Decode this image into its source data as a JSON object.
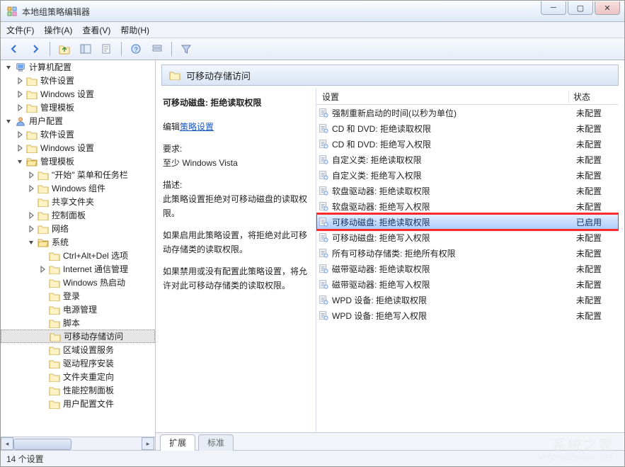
{
  "window": {
    "title": "本地组策略编辑器",
    "min_tooltip": "最小化",
    "max_tooltip": "最大化",
    "close_tooltip": "关闭"
  },
  "menubar": {
    "file": "文件(F)",
    "action": "操作(A)",
    "view": "查看(V)",
    "help": "帮助(H)"
  },
  "toolbar_icons": {
    "back": "back-arrow-icon",
    "forward": "forward-arrow-icon",
    "up": "up-folder-icon",
    "show_hide": "show-hide-tree-icon",
    "properties": "properties-icon",
    "help": "help-icon",
    "options": "options-icon",
    "filter": "filter-icon"
  },
  "tree": {
    "root1": "计算机配置",
    "root1_children": {
      "a": "软件设置",
      "b": "Windows 设置",
      "c": "管理模板"
    },
    "root2": "用户配置",
    "root2_children": {
      "a": "软件设置",
      "b": "Windows 设置",
      "c": "管理模板",
      "c_children": {
        "a": "\"开始\" 菜单和任务栏",
        "b": "Windows 组件",
        "c": "共享文件夹",
        "d": "控制面板",
        "e": "网络",
        "f": "系统",
        "f_children": {
          "a": "Ctrl+Alt+Del 选项",
          "b": "Internet 通信管理",
          "c": "Windows 热启动",
          "d": "登录",
          "e": "电源管理",
          "f": "脚本",
          "g": "可移动存储访问",
          "h": "区域设置服务",
          "i": "驱动程序安装",
          "j": "文件夹重定向",
          "k": "性能控制面板",
          "l": "用户配置文件"
        }
      }
    }
  },
  "content": {
    "header_title": "可移动存储访问",
    "columns": {
      "setting": "设置",
      "state": "状态"
    },
    "rows": [
      {
        "name": "强制重新启动的时间(以秒为单位)",
        "state": "未配置"
      },
      {
        "name": "CD 和 DVD: 拒绝读取权限",
        "state": "未配置"
      },
      {
        "name": "CD 和 DVD: 拒绝写入权限",
        "state": "未配置"
      },
      {
        "name": "自定义类: 拒绝读取权限",
        "state": "未配置"
      },
      {
        "name": "自定义类: 拒绝写入权限",
        "state": "未配置"
      },
      {
        "name": "软盘驱动器: 拒绝读取权限",
        "state": "未配置"
      },
      {
        "name": "软盘驱动器: 拒绝写入权限",
        "state": "未配置"
      },
      {
        "name": "可移动磁盘: 拒绝读取权限",
        "state": "已启用",
        "highlight": true
      },
      {
        "name": "可移动磁盘: 拒绝写入权限",
        "state": "未配置"
      },
      {
        "name": "所有可移动存储类: 拒绝所有权限",
        "state": "未配置"
      },
      {
        "name": "磁带驱动器: 拒绝读取权限",
        "state": "未配置"
      },
      {
        "name": "磁带驱动器: 拒绝写入权限",
        "state": "未配置"
      },
      {
        "name": "WPD 设备: 拒绝读取权限",
        "state": "未配置"
      },
      {
        "name": "WPD 设备: 拒绝写入权限",
        "state": "未配置"
      }
    ],
    "tabs": {
      "extended": "扩展",
      "standard": "标准"
    }
  },
  "description": {
    "title": "可移动磁盘: 拒绝读取权限",
    "edit_prefix": "编辑",
    "edit_link": "策略设置",
    "req_label": "要求:",
    "req_value": "至少 Windows Vista",
    "desc_label": "描述:",
    "desc_body1": "此策略设置拒绝对可移动磁盘的读取权限。",
    "desc_body2": "如果启用此策略设置，将拒绝对此可移动存储类的读取权限。",
    "desc_body3": "如果禁用或没有配置此策略设置，将允许对此可移动存储类的读取权限。"
  },
  "statusbar": {
    "count": "14 个设置"
  },
  "watermark": {
    "big": "系统之家",
    "small": "XITONGZHIJIA.NET"
  }
}
